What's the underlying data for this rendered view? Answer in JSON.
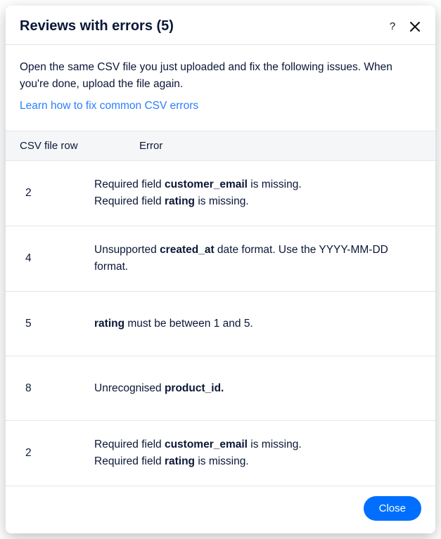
{
  "header": {
    "title": "Reviews with errors (5)"
  },
  "intro": {
    "text": "Open the same CSV file you just uploaded and fix the following issues. When you're done, upload the file again.",
    "link": "Learn how to fix common CSV errors"
  },
  "table": {
    "col_row": "CSV file row",
    "col_error": "Error",
    "rows": [
      {
        "row": "2",
        "lines": [
          {
            "pre": "Required field ",
            "bold": "customer_email",
            "post": " is missing."
          },
          {
            "pre": "Required field ",
            "bold": "rating",
            "post": " is missing."
          }
        ]
      },
      {
        "row": "4",
        "lines": [
          {
            "pre": "Unsupported ",
            "bold": "created_at",
            "post": " date format. Use the YYYY-MM-DD format."
          }
        ]
      },
      {
        "row": "5",
        "lines": [
          {
            "pre": "",
            "bold": "rating",
            "post": " must be between 1 and 5."
          }
        ]
      },
      {
        "row": "8",
        "lines": [
          {
            "pre": "Unrecognised ",
            "bold": "product_id.",
            "post": ""
          }
        ]
      },
      {
        "row": "2",
        "lines": [
          {
            "pre": "Required field ",
            "bold": "customer_email",
            "post": " is missing."
          },
          {
            "pre": "Required field ",
            "bold": "rating",
            "post": " is missing."
          }
        ]
      }
    ]
  },
  "footer": {
    "close": "Close"
  }
}
